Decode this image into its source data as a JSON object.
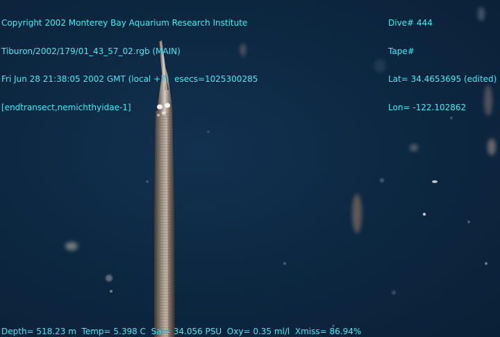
{
  "overlay": {
    "top_left": [
      "Copyright 2002 Monterey Bay Aquarium Research Institute",
      "Tiburon/2002/179/01_43_57_02.rgb (MAIN)",
      "Fri Jun 28 21:38:05 2002 GMT (local +7)  esecs=1025300285",
      "[endtransect,nemichthyidae-1]"
    ],
    "top_right": [
      "Dive# 444",
      "Tape#",
      "Lat= 34.4653695 (edited)",
      "Lon= -122.102862"
    ],
    "bottom": "Depth= 518.23 m  Temp= 5.398 C  Sal= 34.056 PSU  Oxy= 0.35 ml/l  Xmiss= 86.94%"
  },
  "colors": {
    "overlay_text": "#3ff2ff",
    "water": "#0d2842",
    "eel_body": "#8a7a6e"
  },
  "subject": "nemichthyidae-icon"
}
